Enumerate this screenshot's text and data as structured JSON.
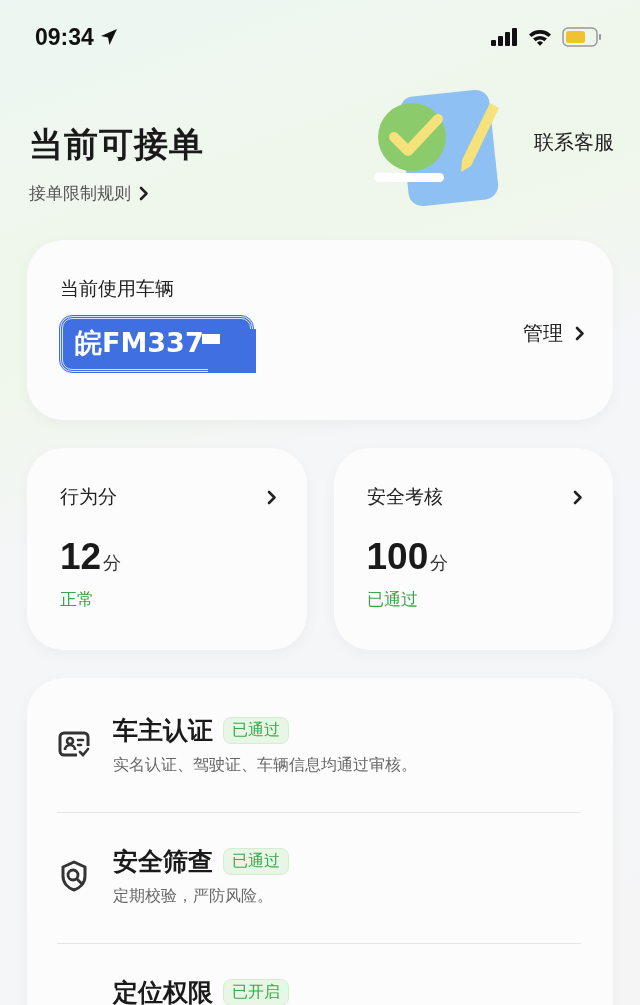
{
  "status_bar": {
    "time": "09:34"
  },
  "header": {
    "title": "当前可接单",
    "rules_link": "接单限制规则",
    "contact": "联系客服"
  },
  "vehicle": {
    "label": "当前使用车辆",
    "plate": "皖FM337",
    "manage": "管理"
  },
  "scores": [
    {
      "title": "行为分",
      "value": "12",
      "unit": "分",
      "status": "正常"
    },
    {
      "title": "安全考核",
      "value": "100",
      "unit": "分",
      "status": "已通过"
    }
  ],
  "checks": [
    {
      "kind": "id-card",
      "title": "车主认证",
      "badge": "已通过",
      "desc": "实名认证、驾驶证、车辆信息均通过审核。"
    },
    {
      "kind": "shield-search",
      "title": "安全筛查",
      "badge": "已通过",
      "desc": "定期校验，严防风险。"
    },
    {
      "kind": "none",
      "title": "定位权限",
      "badge": "已开启"
    }
  ]
}
